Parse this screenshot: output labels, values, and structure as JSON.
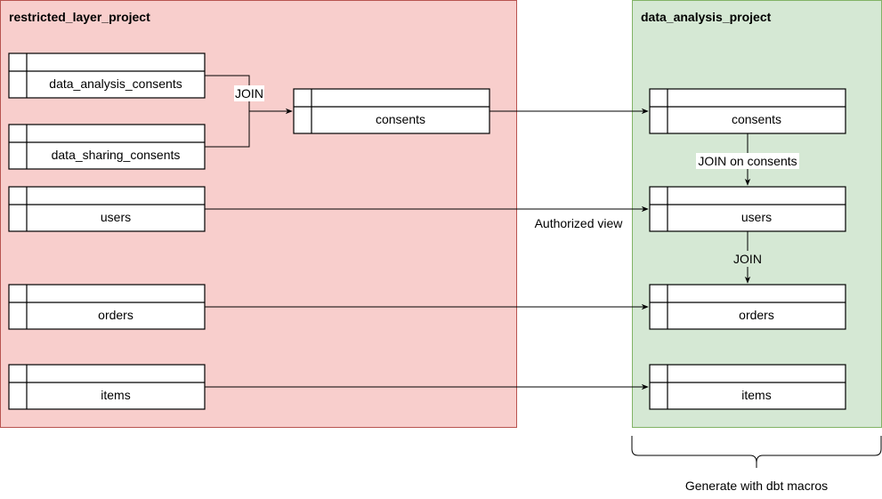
{
  "containers": {
    "restricted": {
      "title": "restricted_layer_project",
      "fill": "#f8cecc",
      "stroke": "#b85450"
    },
    "analysis": {
      "title": "data_analysis_project",
      "fill": "#d5e8d4",
      "stroke": "#82b366"
    }
  },
  "restricted_tables": [
    "data_analysis_consents",
    "data_sharing_consents",
    "users",
    "orders",
    "items"
  ],
  "middle_table": "consents",
  "analysis_tables": [
    "consents",
    "users",
    "orders",
    "items"
  ],
  "edge_labels": {
    "join": "JOIN",
    "join_on_consents": "JOIN on consents",
    "join2": "JOIN",
    "authorized_view": "Authorized view"
  },
  "brace_label": "Generate with dbt macros"
}
